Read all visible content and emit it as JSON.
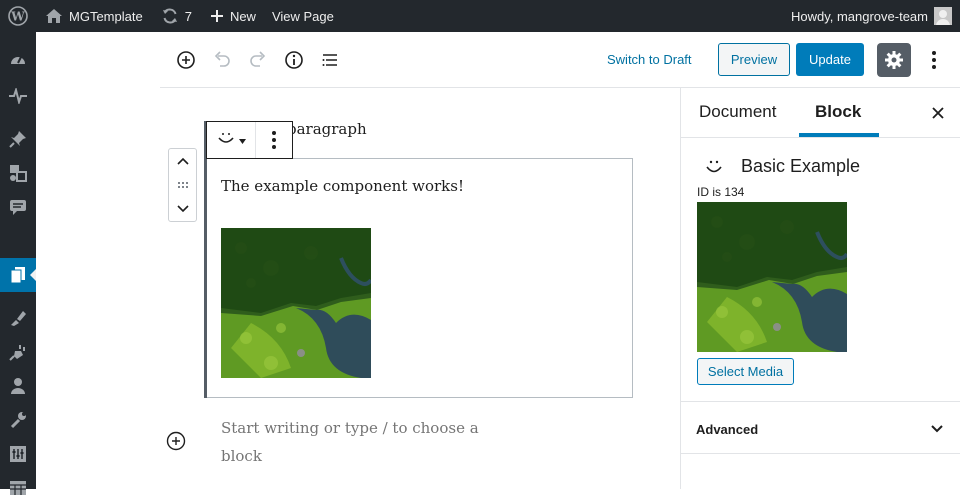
{
  "adminbar": {
    "site_name": "MGTemplate",
    "updates_count": "7",
    "new_label": "New",
    "view_page_label": "View Page",
    "howdy": "Howdy, mangrove-team"
  },
  "editor_header": {
    "switch_to_draft": "Switch to Draft",
    "preview": "Preview",
    "update": "Update"
  },
  "content": {
    "paragraph_behind": "paragraph",
    "block_text": "The example component works!",
    "placeholder": "Start writing or type / to choose a block"
  },
  "sidebar": {
    "tab_document": "Document",
    "tab_block": "Block",
    "block_title": "Basic Example",
    "block_id": "ID is 134",
    "select_media": "Select Media",
    "advanced": "Advanced"
  },
  "colors": {
    "accent": "#007cba",
    "admin_bar": "#23282d",
    "link": "#0071a1"
  },
  "icons": {
    "adminbar": [
      "wordpress-logo-icon",
      "home-icon",
      "updates-icon",
      "plus-icon",
      "user-avatar-icon"
    ],
    "adminmenu": [
      "dashboard-icon",
      "activity-icon",
      "pin-icon",
      "media-icon",
      "comments-icon",
      "pages-icon",
      "appearance-icon",
      "plugins-icon",
      "users-icon",
      "tools-icon",
      "settings-icon",
      "table-icon",
      "gear-icon"
    ],
    "toolbar": [
      "add-block-icon",
      "undo-icon",
      "redo-icon",
      "info-icon",
      "outline-icon",
      "settings-gear-icon",
      "more-vertical-icon"
    ]
  }
}
